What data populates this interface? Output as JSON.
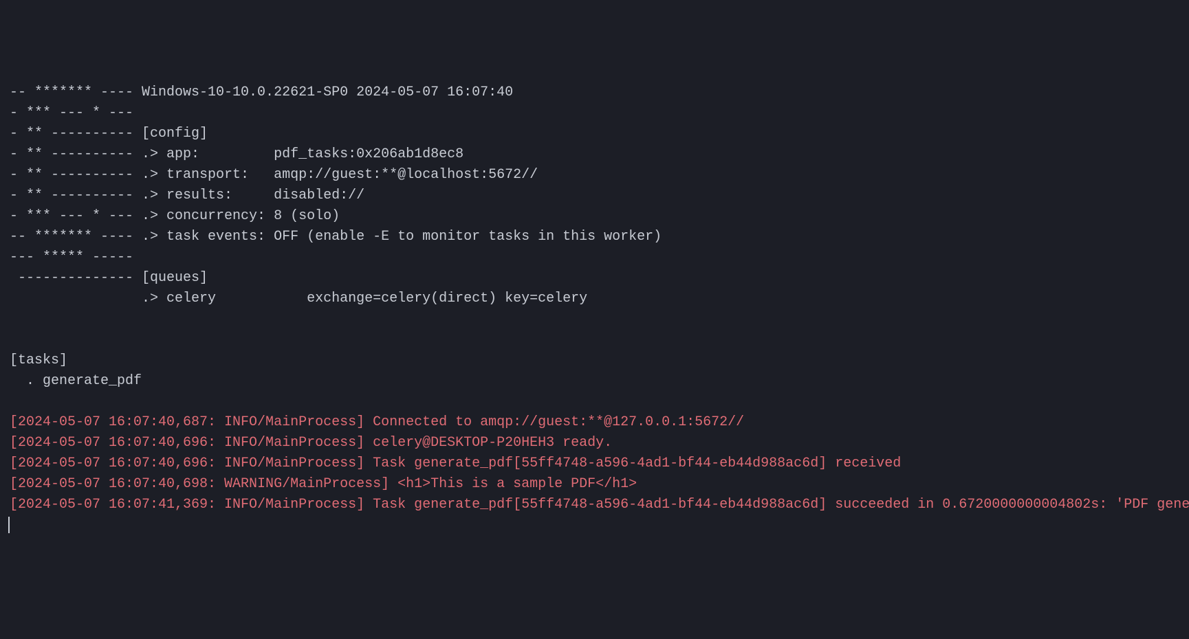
{
  "banner": {
    "line1": "-- ******* ---- Windows-10-10.0.22621-SP0 2024-05-07 16:07:40",
    "line2": "- *** --- * ---",
    "line3": "- ** ---------- [config]",
    "line4": "- ** ---------- .> app:         pdf_tasks:0x206ab1d8ec8",
    "line5": "- ** ---------- .> transport:   amqp://guest:**@localhost:5672//",
    "line6": "- ** ---------- .> results:     disabled://",
    "line7": "- *** --- * --- .> concurrency: 8 (solo)",
    "line8": "-- ******* ---- .> task events: OFF (enable -E to monitor tasks in this worker)",
    "line9": "--- ***** -----",
    "line10": " -------------- [queues]",
    "line11": "                .> celery           exchange=celery(direct) key=celery"
  },
  "tasks": {
    "header": "[tasks]",
    "item1": "  . generate_pdf"
  },
  "logs": {
    "line1": "[2024-05-07 16:07:40,687: INFO/MainProcess] Connected to amqp://guest:**@127.0.0.1:5672//",
    "line2": "[2024-05-07 16:07:40,696: INFO/MainProcess] celery@DESKTOP-P20HEH3 ready.",
    "line3": "[2024-05-07 16:07:40,696: INFO/MainProcess] Task generate_pdf[55ff4748-a596-4ad1-bf44-eb44d988ac6d] received",
    "line4": "[2024-05-07 16:07:40,698: WARNING/MainProcess] <h1>This is a sample PDF</h1>",
    "line5": "[2024-05-07 16:07:41,369: INFO/MainProcess] Task generate_pdf[55ff4748-a596-4ad1-bf44-eb44d988ac6d] succeeded in 0.6720000000004802s: 'PDF gene"
  }
}
